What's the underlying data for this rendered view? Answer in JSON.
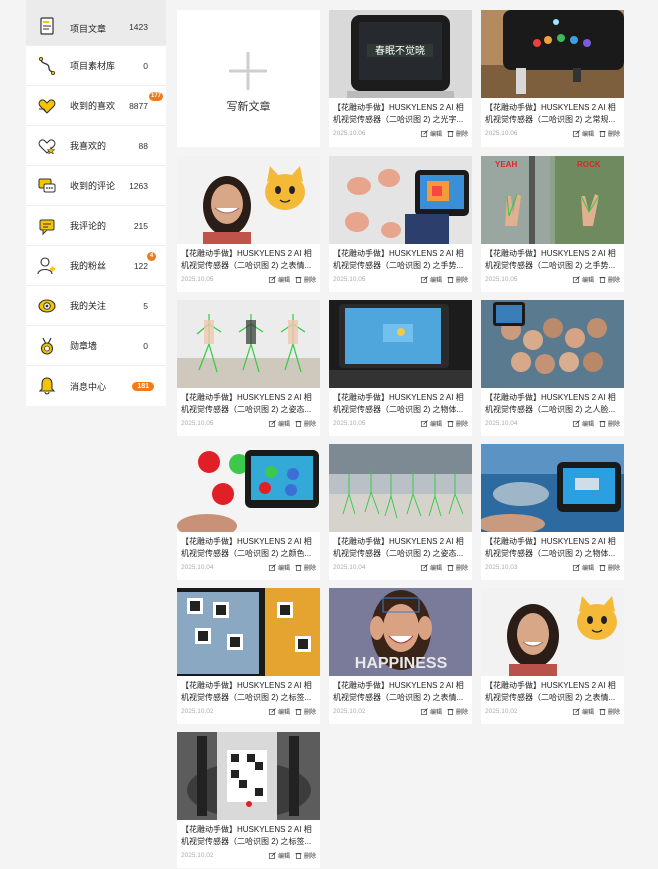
{
  "sidebar": {
    "items": [
      {
        "label": "项目文章",
        "count": "1423",
        "icon": "article-icon"
      },
      {
        "label": "项目素材库",
        "count": "0",
        "icon": "material-icon"
      },
      {
        "label": "收到的喜欢",
        "count": "8877",
        "badge": "177",
        "icon": "heart-received-icon"
      },
      {
        "label": "我喜欢的",
        "count": "88",
        "icon": "heart-star-icon"
      },
      {
        "label": "收到的评论",
        "count": "1263",
        "icon": "comments-received-icon"
      },
      {
        "label": "我评论的",
        "count": "215",
        "icon": "my-comments-icon"
      },
      {
        "label": "我的粉丝",
        "count": "122",
        "badge": "4",
        "icon": "fans-icon"
      },
      {
        "label": "我的关注",
        "count": "5",
        "icon": "follow-icon"
      },
      {
        "label": "勋章墙",
        "count": "0",
        "icon": "medal-icon"
      },
      {
        "label": "消息中心",
        "count": "181",
        "icon": "bell-icon"
      }
    ]
  },
  "new_article": {
    "label": "写新文章"
  },
  "actions": {
    "edit": "编辑",
    "delete": "删除"
  },
  "thumb_texts": {
    "ocr_screen": "春眠不觉晓",
    "happiness": "HAPPINESS",
    "yeah_left": "YEAH",
    "yeah_right": "ROCK"
  },
  "articles": [
    {
      "title": "【花雕动手做】HUSKYLENS 2 AI 相机视觉传感器（二哈识图 2) 之光字...",
      "date": "2025.10.06"
    },
    {
      "title": "【花雕动手做】HUSKYLENS 2 AI 相机视觉传感器（二哈识图 2) 之常规...",
      "date": "2025.10.06"
    },
    {
      "title": "【花雕动手做】HUSKYLENS 2 AI 相机视觉传感器（二哈识图 2) 之表情...",
      "date": "2025.10.05"
    },
    {
      "title": "【花雕动手做】HUSKYLENS 2 AI 相机视觉传感器（二哈识图 2) 之手势...",
      "date": "2025.10.05"
    },
    {
      "title": "【花雕动手做】HUSKYLENS 2 AI 相机视觉传感器（二哈识图 2) 之手势...",
      "date": "2025.10.05"
    },
    {
      "title": "【花雕动手做】HUSKYLENS 2 AI 相机视觉传感器（二哈识图 2) 之姿态...",
      "date": "2025.10.05"
    },
    {
      "title": "【花雕动手做】HUSKYLENS 2 AI 相机视觉传感器（二哈识图 2) 之物体...",
      "date": "2025.10.05"
    },
    {
      "title": "【花雕动手做】HUSKYLENS 2 AI 相机视觉传感器（二哈识图 2) 之人脸...",
      "date": "2025.10.04"
    },
    {
      "title": "【花雕动手做】HUSKYLENS 2 AI 相机视觉传感器（二哈识图 2) 之颜色...",
      "date": "2025.10.04"
    },
    {
      "title": "【花雕动手做】HUSKYLENS 2 AI 相机视觉传感器（二哈识图 2) 之姿态...",
      "date": "2025.10.04"
    },
    {
      "title": "【花雕动手做】HUSKYLENS 2 AI 相机视觉传感器（二哈识图 2) 之物体...",
      "date": "2025.10.03"
    },
    {
      "title": "【花雕动手做】HUSKYLENS 2 AI 相机视觉传感器（二哈识图 2) 之标签...",
      "date": "2025.10.02"
    },
    {
      "title": "【花雕动手做】HUSKYLENS 2 AI 相机视觉传感器（二哈识图 2) 之表情...",
      "date": "2025.10.02"
    },
    {
      "title": "【花雕动手做】HUSKYLENS 2 AI 相机视觉传感器（二哈识图 2) 之表情...",
      "date": "2025.10.02"
    },
    {
      "title": "【花雕动手做】HUSKYLENS 2 AI 相机视觉传感器（二哈识图 2) 之标签...",
      "date": "2025.10.02"
    }
  ],
  "colors": {
    "accent": "#f07b1d",
    "icon_yellow": "#f5c400"
  }
}
